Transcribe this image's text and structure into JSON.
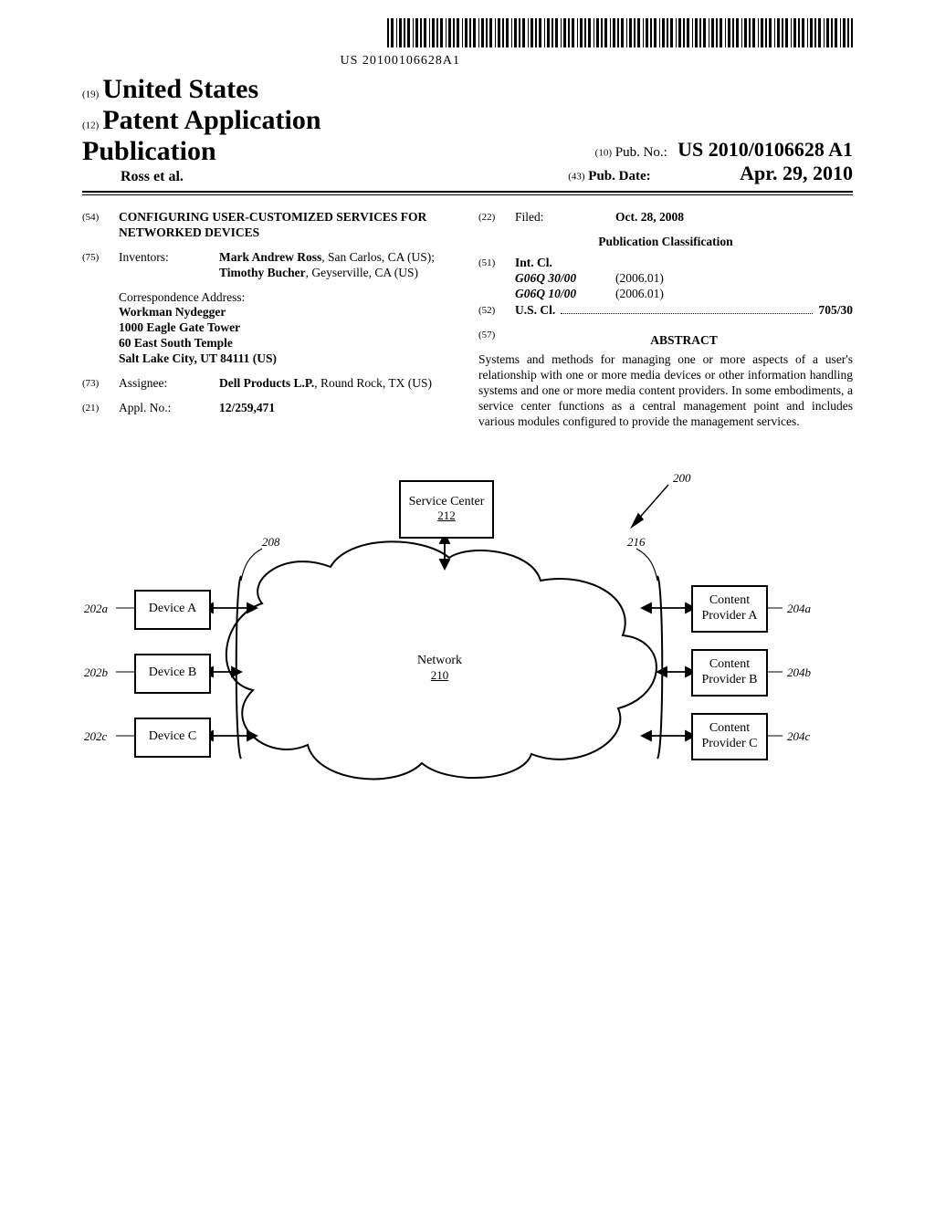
{
  "barcode_text": "US 20100106628A1",
  "header": {
    "country_code": "(19)",
    "country": "United States",
    "pubtype_code": "(12)",
    "pubtype": "Patent Application Publication",
    "authors_short": "Ross et al.",
    "pubno_code": "(10)",
    "pubno_label": "Pub. No.:",
    "pubno_value": "US 2010/0106628 A1",
    "pubdate_code": "(43)",
    "pubdate_label": "Pub. Date:",
    "pubdate_value": "Apr. 29, 2010"
  },
  "left_col": {
    "title_code": "(54)",
    "title": "CONFIGURING USER-CUSTOMIZED SERVICES FOR NETWORKED DEVICES",
    "inventors_code": "(75)",
    "inventors_label": "Inventors:",
    "inventors_html": "Mark Andrew Ross, San Carlos, CA (US); Timothy Bucher, Geyserville, CA (US)",
    "inventor1_name": "Mark Andrew Ross",
    "inventor1_rest": ", San Carlos, CA (US); ",
    "inventor2_name": "Timothy Bucher",
    "inventor2_rest": ", Geyserville, CA (US)",
    "corr_label": "Correspondence Address:",
    "corr_line1": "Workman Nydegger",
    "corr_line2": "1000 Eagle Gate Tower",
    "corr_line3": "60 East South Temple",
    "corr_line4": "Salt Lake City, UT 84111 (US)",
    "assignee_code": "(73)",
    "assignee_label": "Assignee:",
    "assignee_name": "Dell Products L.P.",
    "assignee_rest": ", Round Rock, TX (US)",
    "applno_code": "(21)",
    "applno_label": "Appl. No.:",
    "applno_value": "12/259,471"
  },
  "right_col": {
    "filed_code": "(22)",
    "filed_label": "Filed:",
    "filed_value": "Oct. 28, 2008",
    "pubclass_heading": "Publication Classification",
    "intcl_code": "(51)",
    "intcl_label": "Int. Cl.",
    "intcl1_sym": "G06Q 30/00",
    "intcl1_date": "(2006.01)",
    "intcl2_sym": "G06Q 10/00",
    "intcl2_date": "(2006.01)",
    "uscl_code": "(52)",
    "uscl_label": "U.S. Cl.",
    "uscl_value": "705/30",
    "abstract_code": "(57)",
    "abstract_heading": "ABSTRACT",
    "abstract_text": "Systems and methods for managing one or more aspects of a user's relationship with one or more media devices or other information handling systems and one or more media content providers. In some embodiments, a service center functions as a central management point and includes various modules configured to provide the management services."
  },
  "figure": {
    "ref_200": "200",
    "service_center": "Service Center",
    "service_center_ref": "212",
    "network": "Network",
    "network_ref": "210",
    "ref_208": "208",
    "ref_216": "216",
    "devA": "Device A",
    "devA_ref": "202a",
    "devB": "Device B",
    "devB_ref": "202b",
    "devC": "Device C",
    "devC_ref": "202c",
    "cpA": "Content Provider A",
    "cpA_ref": "204a",
    "cpB": "Content Provider B",
    "cpB_ref": "204b",
    "cpC": "Content Provider C",
    "cpC_ref": "204c"
  }
}
